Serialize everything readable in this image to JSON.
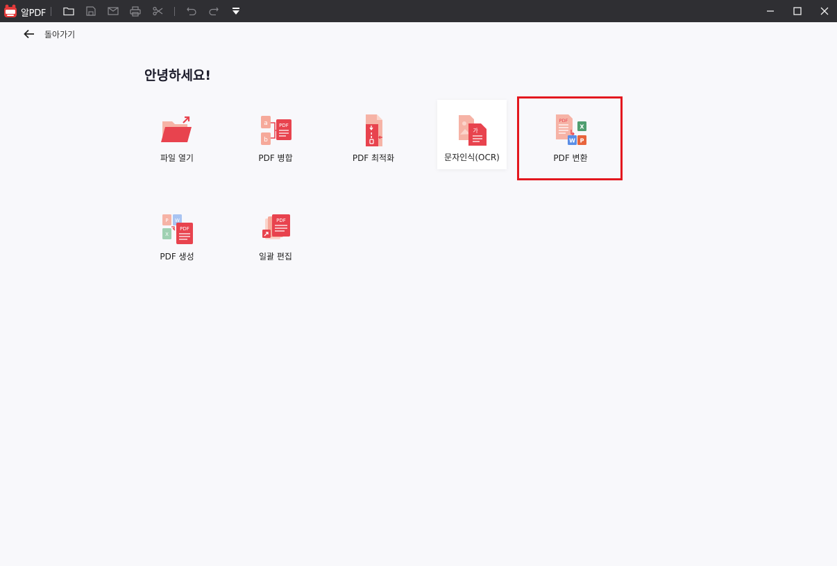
{
  "titlebar": {
    "app_name": "알PDF",
    "toolbar_icons": [
      "folder-icon",
      "save-icon",
      "mail-icon",
      "print-icon",
      "scissors-icon",
      "undo-icon",
      "redo-icon",
      "dropdown-icon"
    ],
    "window_controls": [
      "minimize-icon",
      "maximize-icon",
      "close-icon"
    ]
  },
  "back": {
    "label": "돌아가기"
  },
  "greeting": "안녕하세요!",
  "tiles": [
    {
      "label": "파일 열기",
      "icon": "open-folder-icon"
    },
    {
      "label": "PDF 병합",
      "icon": "pdf-merge-icon"
    },
    {
      "label": "PDF 최적화",
      "icon": "pdf-compress-icon"
    },
    {
      "label": "문자인식(OCR)",
      "icon": "ocr-icon"
    },
    {
      "label": "PDF 변환",
      "icon": "pdf-convert-icon"
    },
    {
      "label": "PDF 생성",
      "icon": "pdf-create-icon"
    },
    {
      "label": "일괄 편집",
      "icon": "batch-edit-icon"
    }
  ],
  "icon_text": {
    "pdf": "PDF",
    "a": "a",
    "b": "b",
    "ga": "가",
    "x": "X",
    "w": "W",
    "p": "P"
  },
  "colors": {
    "accent": "#e8434e",
    "accent_light": "#f6a99a",
    "highlight": "#e3171e",
    "titlebar": "#2f2f33"
  }
}
